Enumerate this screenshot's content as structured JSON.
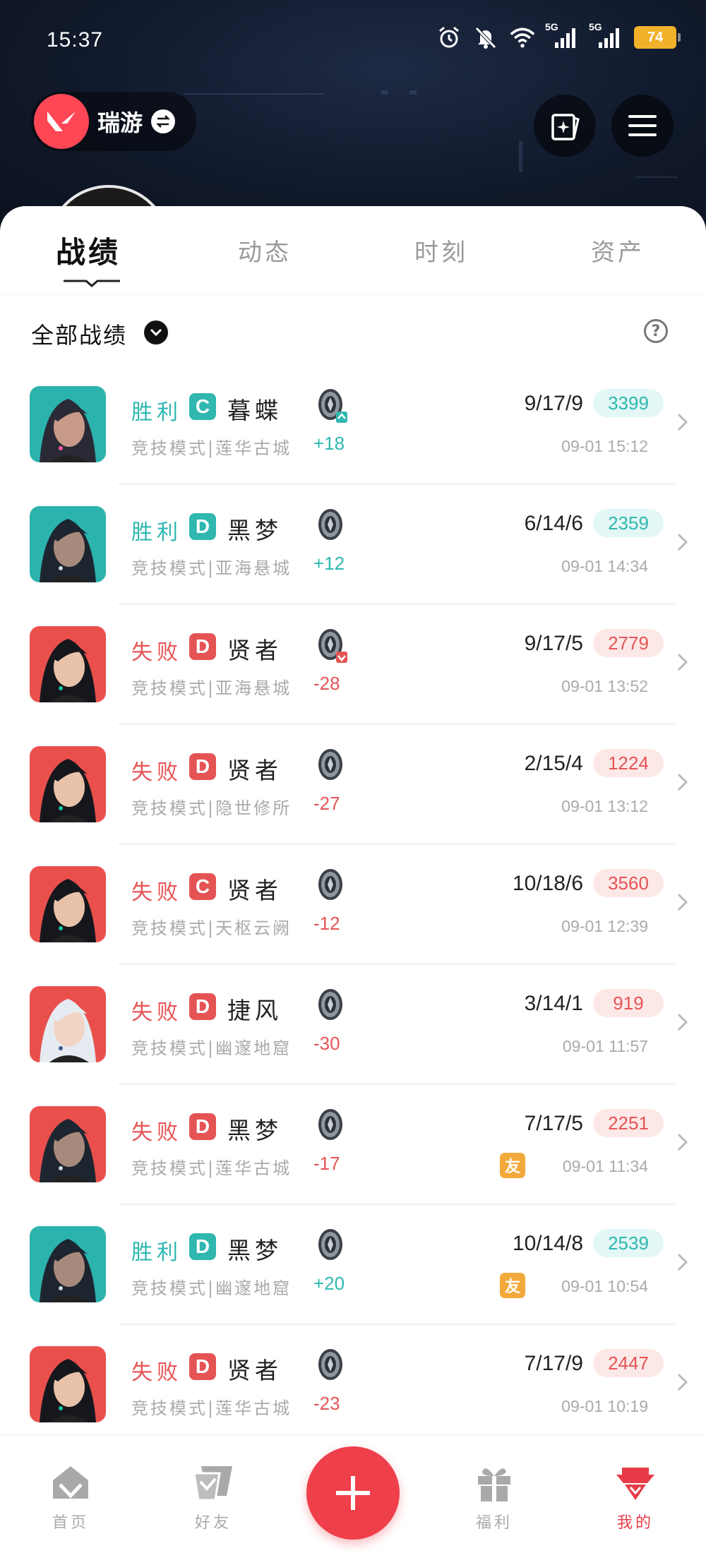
{
  "status_bar": {
    "time": "15:37",
    "battery": "74",
    "signal_labels": [
      "5G",
      "5G"
    ]
  },
  "header": {
    "game_name": "瑞游"
  },
  "tabs": [
    {
      "label": "战绩",
      "active": true
    },
    {
      "label": "动态",
      "active": false
    },
    {
      "label": "时刻",
      "active": false
    },
    {
      "label": "资产",
      "active": false
    }
  ],
  "filter": {
    "label": "全部战绩"
  },
  "colors": {
    "win": "#2fb7b0",
    "loss": "#e55454",
    "rank_c_win": "#2fb7b0",
    "rank_loss": "#e55454",
    "accent": "#ee3f4a"
  },
  "matches": [
    {
      "result": "胜利",
      "outcome": "win",
      "rank": "C",
      "agent": "暮蝶",
      "mode": "竞技模式|莲华古城",
      "rr": "+18",
      "kda": "9/17/9",
      "score": "3399",
      "date": "09-01 15:12",
      "friend": "",
      "emblem_arrow": "up",
      "portrait": "teal-pink"
    },
    {
      "result": "胜利",
      "outcome": "win",
      "rank": "D",
      "agent": "黑梦",
      "mode": "竞技模式|亚海悬城",
      "rr": "+12",
      "kda": "6/14/6",
      "score": "2359",
      "date": "09-01 14:34",
      "friend": "",
      "emblem_arrow": "",
      "portrait": "teal-dark"
    },
    {
      "result": "失败",
      "outcome": "loss",
      "rank": "D",
      "agent": "贤者",
      "mode": "竞技模式|亚海悬城",
      "rr": "-28",
      "kda": "9/17/5",
      "score": "2779",
      "date": "09-01 13:52",
      "friend": "",
      "emblem_arrow": "down",
      "portrait": "red-sage"
    },
    {
      "result": "失败",
      "outcome": "loss",
      "rank": "D",
      "agent": "贤者",
      "mode": "竞技模式|隐世修所",
      "rr": "-27",
      "kda": "2/15/4",
      "score": "1224",
      "date": "09-01 13:12",
      "friend": "",
      "emblem_arrow": "",
      "portrait": "red-sage"
    },
    {
      "result": "失败",
      "outcome": "loss",
      "rank": "C",
      "agent": "贤者",
      "mode": "竞技模式|天枢云阙",
      "rr": "-12",
      "kda": "10/18/6",
      "score": "3560",
      "date": "09-01 12:39",
      "friend": "",
      "emblem_arrow": "",
      "portrait": "red-sage"
    },
    {
      "result": "失败",
      "outcome": "loss",
      "rank": "D",
      "agent": "捷风",
      "mode": "竞技模式|幽邃地窟",
      "rr": "-30",
      "kda": "3/14/1",
      "score": "919",
      "date": "09-01 11:57",
      "friend": "",
      "emblem_arrow": "",
      "portrait": "red-jett"
    },
    {
      "result": "失败",
      "outcome": "loss",
      "rank": "D",
      "agent": "黑梦",
      "mode": "竞技模式|莲华古城",
      "rr": "-17",
      "kda": "7/17/5",
      "score": "2251",
      "date": "09-01 11:34",
      "friend": "友",
      "emblem_arrow": "",
      "portrait": "red-dark"
    },
    {
      "result": "胜利",
      "outcome": "win",
      "rank": "D",
      "agent": "黑梦",
      "mode": "竞技模式|幽邃地窟",
      "rr": "+20",
      "kda": "10/14/8",
      "score": "2539",
      "date": "09-01 10:54",
      "friend": "友",
      "emblem_arrow": "",
      "portrait": "teal-dark"
    },
    {
      "result": "失败",
      "outcome": "loss",
      "rank": "D",
      "agent": "贤者",
      "mode": "竞技模式|莲华古城",
      "rr": "-23",
      "kda": "7/17/9",
      "score": "2447",
      "date": "09-01 10:19",
      "friend": "",
      "emblem_arrow": "",
      "portrait": "red-sage"
    }
  ],
  "bottom_nav": [
    {
      "label": "首页",
      "icon": "home-icon",
      "active": false
    },
    {
      "label": "好友",
      "icon": "friends-icon",
      "active": false
    },
    {
      "label": "",
      "icon": "plus-icon",
      "active": false
    },
    {
      "label": "福利",
      "icon": "gift-icon",
      "active": false
    },
    {
      "label": "我的",
      "icon": "profile-icon",
      "active": true
    }
  ]
}
